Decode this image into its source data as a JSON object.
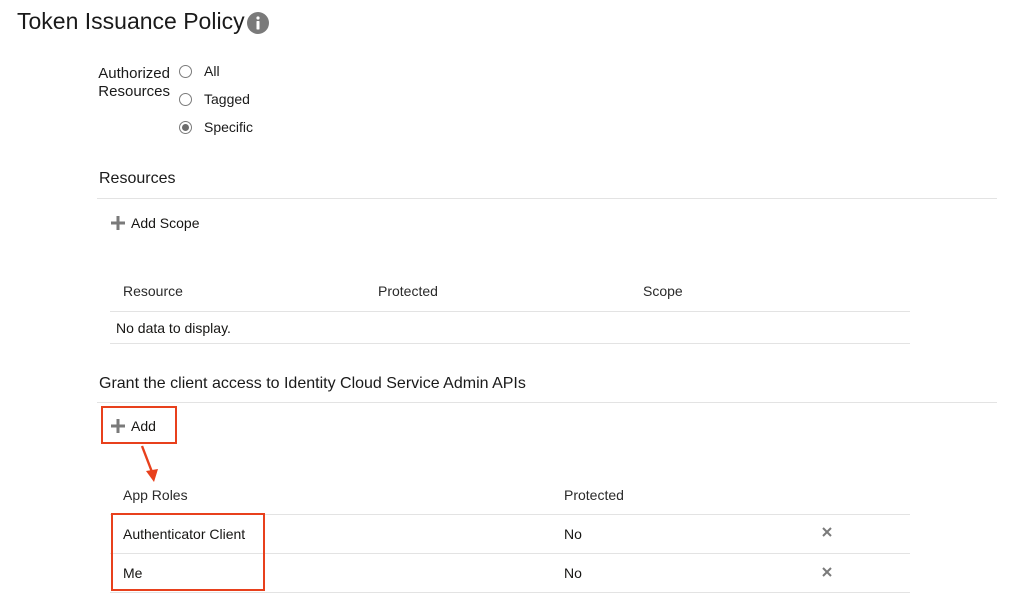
{
  "page": {
    "title": "Token Issuance Policy",
    "info_icon": "info-circle-icon"
  },
  "authorized_resources": {
    "label": "Authorized Resources",
    "options": [
      {
        "label": "All",
        "selected": false
      },
      {
        "label": "Tagged",
        "selected": false
      },
      {
        "label": "Specific",
        "selected": true
      }
    ]
  },
  "resources": {
    "title": "Resources",
    "add_scope_label": "Add Scope",
    "columns": [
      "Resource",
      "Protected",
      "Scope"
    ],
    "empty_text": "No data to display."
  },
  "admin_apis": {
    "title": "Grant the client access to Identity Cloud Service Admin APIs",
    "add_label": "Add",
    "columns": [
      "App Roles",
      "Protected"
    ],
    "rows": [
      {
        "app_role": "Authenticator Client",
        "protected": "No"
      },
      {
        "app_role": "Me",
        "protected": "No"
      }
    ]
  },
  "colors": {
    "annotation": "#e8401c",
    "divider": "#e3e3e3",
    "icon": "#7a7a7a"
  }
}
